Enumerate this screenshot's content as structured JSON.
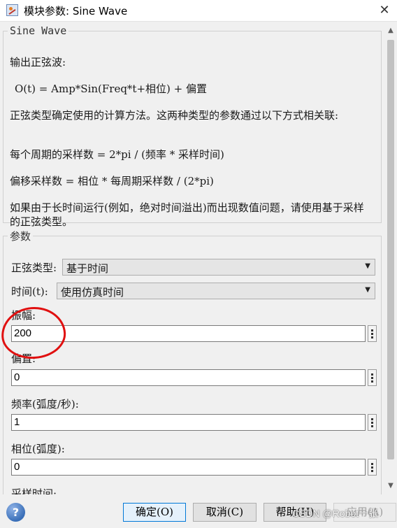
{
  "window": {
    "title": "模块参数: Sine Wave",
    "close_glyph": "✕"
  },
  "description": {
    "legend": "Sine Wave",
    "lines": [
      "输出正弦波:",
      "O(t) = Amp*Sin(Freq*t+相位) + 偏置",
      "正弦类型确定使用的计算方法。这两种类型的参数通过以下方式相关联:",
      "每个周期的采样数 = 2*pi / (频率 * 采样时间)",
      "偏移采样数 = 相位 * 每周期采样数 / (2*pi)",
      "如果由于长时间运行(例如，绝对时间溢出)而出现数值问题，请使用基于采样的正弦类型。"
    ]
  },
  "parameters": {
    "legend": "参数",
    "sine_type": {
      "label": "正弦类型:",
      "value": "基于时间"
    },
    "time": {
      "label": "时间(t):",
      "value": "使用仿真时间"
    },
    "amplitude": {
      "label": "振幅:",
      "value": "200"
    },
    "bias": {
      "label": "偏置:",
      "value": "0"
    },
    "frequency": {
      "label": "频率(弧度/秒):",
      "value": "1"
    },
    "phase": {
      "label": "相位(弧度):",
      "value": "0"
    },
    "sample_time": {
      "label": "采样时间:"
    }
  },
  "buttons": {
    "ok": "确定(O)",
    "cancel": "取消(C)",
    "help": "帮助(H)",
    "apply": "应用(A)",
    "help_icon": "?"
  },
  "icons": {
    "app": "simulink-block-icon",
    "help": "help-icon",
    "dropdown": "▼",
    "scroll_up": "▲",
    "scroll_down": "▼"
  },
  "watermark": "CSDN @Robot一张",
  "colors": {
    "annotation_circle": "#e01010",
    "focus_border": "#0078d7"
  }
}
